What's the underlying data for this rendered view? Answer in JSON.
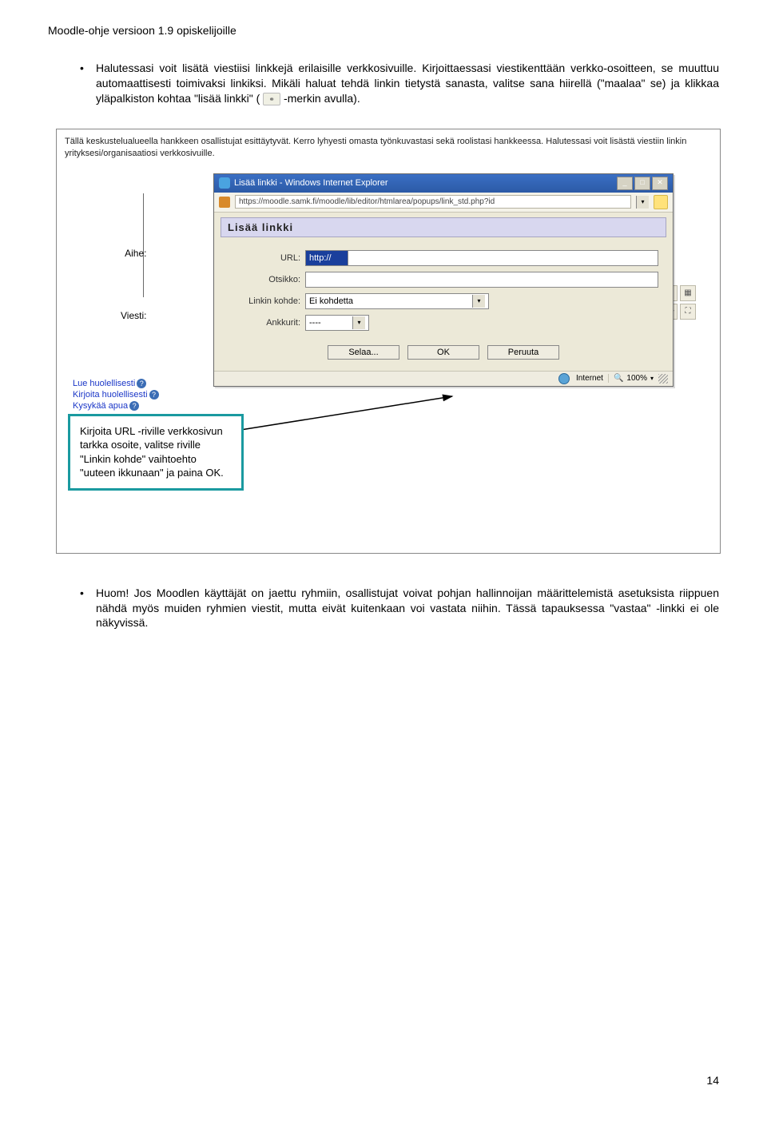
{
  "header": "Moodle-ohje versioon 1.9 opiskelijoille",
  "bullet1_part1": "Halutessasi voit lisätä viestiisi linkkejä erilaisille verkkosivuille. Kirjoittaessasi viestikenttään verkko-osoitteen, se muuttuu automaattisesti toimivaksi linkiksi. Mikäli haluat tehdä linkin tietystä sanasta, valitse sana hiirellä (\"maalaa\" se) ja klikkaa yläpalkiston kohtaa \"lisää linkki\" (",
  "bullet1_part2": "-merkin avulla).",
  "screenshot": {
    "intro": "Tällä keskustelualueella hankkeen osallistujat esittäytyvät. Kerro lyhyesti omasta työnkuvastasi sekä roolistasi hankkeessa. Halutessasi voit lisästä viestiin linkin yrityksesi/organisaatiosi verkkosivuille.",
    "label_aihe": "Aihe:",
    "label_viesti": "Viesti:",
    "links": [
      "Lue huolellisesti",
      "Kirjoita huolellisesti",
      "Kysykää apua"
    ],
    "dialog": {
      "title": "Lisää linkki - Windows Internet Explorer",
      "url_display": "https://moodle.samk.fi/moodle/lib/editor/htmlarea/popups/link_std.php?id",
      "subtitle": "Lisää linkki",
      "field_url_label": "URL:",
      "field_url_value": "http://",
      "field_title_label": "Otsikko:",
      "field_target_label": "Linkin kohde:",
      "field_target_value": "Ei kohdetta",
      "field_anchor_label": "Ankkurit:",
      "field_anchor_value": "----",
      "btn_browse": "Selaa...",
      "btn_ok": "OK",
      "btn_cancel": "Peruuta",
      "status_zone": "Internet",
      "status_zoom": "100%"
    }
  },
  "callout_text": "Kirjoita URL -riville verkkosivun tarkka osoite, valitse riville \"Linkin kohde\" vaihtoehto \"uuteen ikkunaan\" ja paina OK.",
  "bullet2": "Huom! Jos Moodlen käyttäjät on jaettu ryhmiin, osallistujat voivat pohjan hallinnoijan määrittelemistä asetuksista riippuen nähdä myös muiden ryhmien viestit, mutta eivät kuitenkaan voi vastata niihin. Tässä tapauksessa \"vastaa\" -linkki ei ole näkyvissä.",
  "page_number": "14"
}
